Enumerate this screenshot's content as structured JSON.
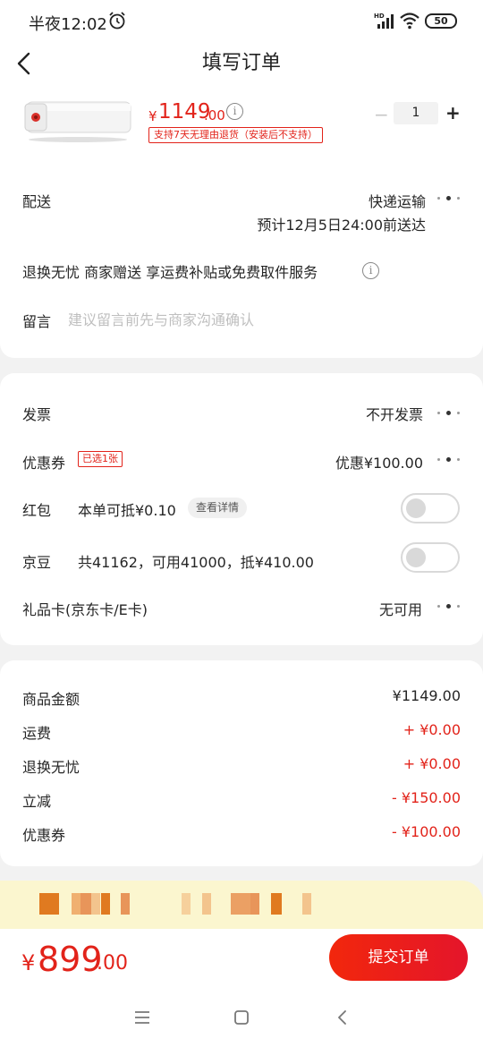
{
  "status_bar": {
    "time": "半夜12:02",
    "battery": "50"
  },
  "nav": {
    "title": "填写订单"
  },
  "product": {
    "price_currency": "¥",
    "price_int": "1149",
    "price_dec": ".00",
    "return_policy": "支持7天无理由退货（安装后不支持）",
    "quantity": "1",
    "minus": "−",
    "plus": "+"
  },
  "delivery": {
    "label": "配送",
    "method": "快递运输",
    "estimate": "预计12月5日24:00前送达"
  },
  "service": {
    "text": "退换无忧 商家赠送 享运费补贴或免费取件服务",
    "info": "i"
  },
  "note": {
    "label": "留言",
    "placeholder": "建议留言前先与商家沟通确认"
  },
  "invoice": {
    "label": "发票",
    "value": "不开发票"
  },
  "coupon": {
    "label": "优惠券",
    "tag": "已选1张",
    "value": "优惠¥100.00"
  },
  "redpacket": {
    "label": "红包",
    "desc": "本单可抵¥0.10",
    "detail": "查看详情",
    "enabled": false
  },
  "jingdou": {
    "label": "京豆",
    "desc": "共41162，可用41000，抵¥410.00",
    "enabled": false
  },
  "giftcard": {
    "label": "礼品卡(京东卡/E卡)",
    "value": "无可用"
  },
  "summary": [
    {
      "label": "商品金额",
      "value": "¥1149.00",
      "red": false
    },
    {
      "label": "运费",
      "value": "+ ¥0.00",
      "red": true
    },
    {
      "label": "退换无忧",
      "value": "+ ¥0.00",
      "red": true
    },
    {
      "label": "立减",
      "value": "- ¥150.00",
      "red": true
    },
    {
      "label": "优惠券",
      "value": "- ¥100.00",
      "red": true
    }
  ],
  "total": {
    "currency": "¥",
    "int": "899",
    "dec": ".00"
  },
  "submit": {
    "label": "提交订单"
  },
  "colors": {
    "accent_red": "#e2231a",
    "banner_bg": "#fbf6cf"
  }
}
